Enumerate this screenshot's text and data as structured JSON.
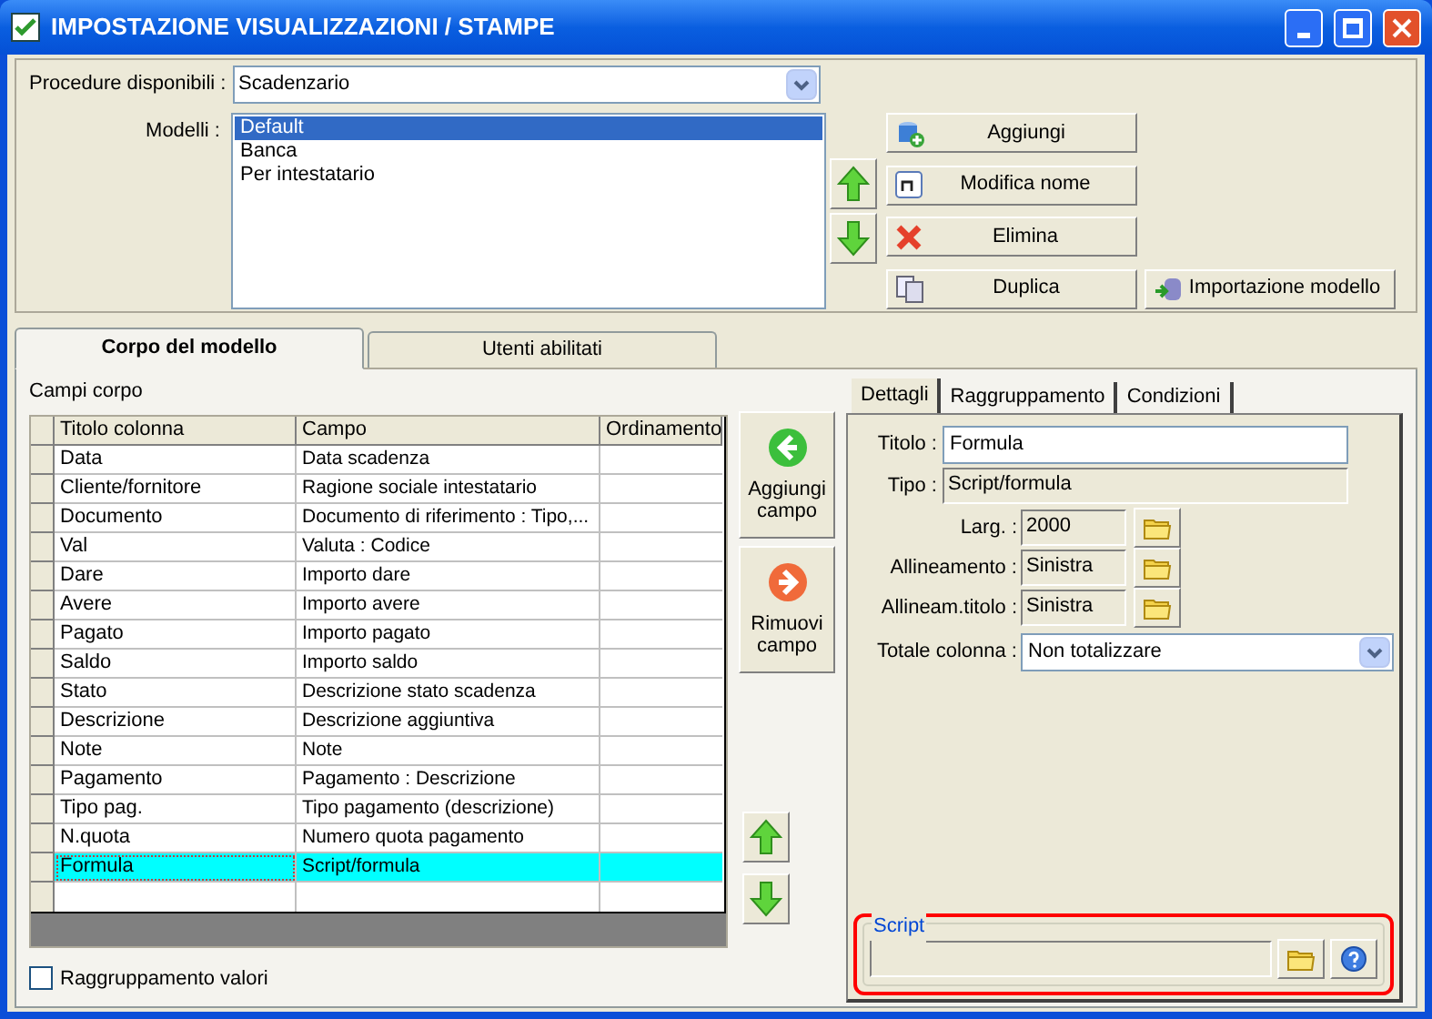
{
  "window": {
    "title": "IMPOSTAZIONE VISUALIZZAZIONI / STAMPE"
  },
  "procedure": {
    "label": "Procedure disponibili :",
    "value": "Scadenzario"
  },
  "models": {
    "label": "Modelli :",
    "items": [
      {
        "label": "Default",
        "selected": true
      },
      {
        "label": "Banca",
        "selected": false
      },
      {
        "label": "Per intestatario",
        "selected": false
      }
    ]
  },
  "model_buttons": [
    {
      "label": "Aggiungi",
      "kind": "add"
    },
    {
      "label": "Modifica nome",
      "kind": "rename"
    },
    {
      "label": "Elimina",
      "kind": "delete"
    },
    {
      "label": "Duplica",
      "kind": "duplicate"
    },
    {
      "label": "Importazione modello",
      "kind": "import"
    }
  ],
  "main_tabs": [
    {
      "label": "Corpo del modello",
      "selected": true
    },
    {
      "label": "Utenti abilitati",
      "selected": false
    }
  ],
  "fields": {
    "label": "Campi corpo",
    "columns": [
      "Titolo colonna",
      "Campo",
      "Ordinamento"
    ],
    "rows": [
      {
        "title": "Data",
        "field": "Data scadenza",
        "selected": false
      },
      {
        "title": "Cliente/fornitore",
        "field": "Ragione sociale intestatario",
        "selected": false
      },
      {
        "title": "Documento",
        "field": "Documento di riferimento : Tipo,...",
        "selected": false
      },
      {
        "title": "Val",
        "field": "Valuta : Codice",
        "selected": false
      },
      {
        "title": "Dare",
        "field": "Importo dare",
        "selected": false
      },
      {
        "title": "Avere",
        "field": "Importo avere",
        "selected": false
      },
      {
        "title": "Pagato",
        "field": "Importo pagato",
        "selected": false
      },
      {
        "title": "Saldo",
        "field": "Importo saldo",
        "selected": false
      },
      {
        "title": "Stato",
        "field": "Descrizione stato scadenza",
        "selected": false
      },
      {
        "title": "Descrizione",
        "field": "Descrizione aggiuntiva",
        "selected": false
      },
      {
        "title": "Note",
        "field": "Note",
        "selected": false
      },
      {
        "title": "Pagamento",
        "field": "Pagamento : Descrizione",
        "selected": false
      },
      {
        "title": "Tipo pag.",
        "field": "Tipo pagamento (descrizione)",
        "selected": false
      },
      {
        "title": "N.quota",
        "field": "Numero quota pagamento",
        "selected": false
      },
      {
        "title": "Formula",
        "field": "Script/formula",
        "selected": true
      }
    ]
  },
  "field_buttons": [
    {
      "label": "Aggiungi campo",
      "kind": "add"
    },
    {
      "label": "Rimuovi campo",
      "kind": "remove"
    }
  ],
  "grouping": {
    "label": "Raggruppamento valori",
    "checked": false
  },
  "detail_tabs": [
    {
      "label": "Dettagli",
      "selected": true
    },
    {
      "label": "Raggruppamento",
      "selected": false
    },
    {
      "label": "Condizioni",
      "selected": false
    }
  ],
  "details": {
    "title": {
      "label": "Titolo :",
      "value": "Formula"
    },
    "type": {
      "label": "Tipo :",
      "value": "Script/formula"
    },
    "props": [
      {
        "label": "Larg. :",
        "value": "2000"
      },
      {
        "label": "Allineamento :",
        "value": "Sinistra"
      },
      {
        "label": "Allineam.titolo :",
        "value": "Sinistra"
      }
    ],
    "total": {
      "label": "Totale colonna :",
      "value": "Non totalizzare"
    }
  },
  "script": {
    "label": "Script"
  }
}
